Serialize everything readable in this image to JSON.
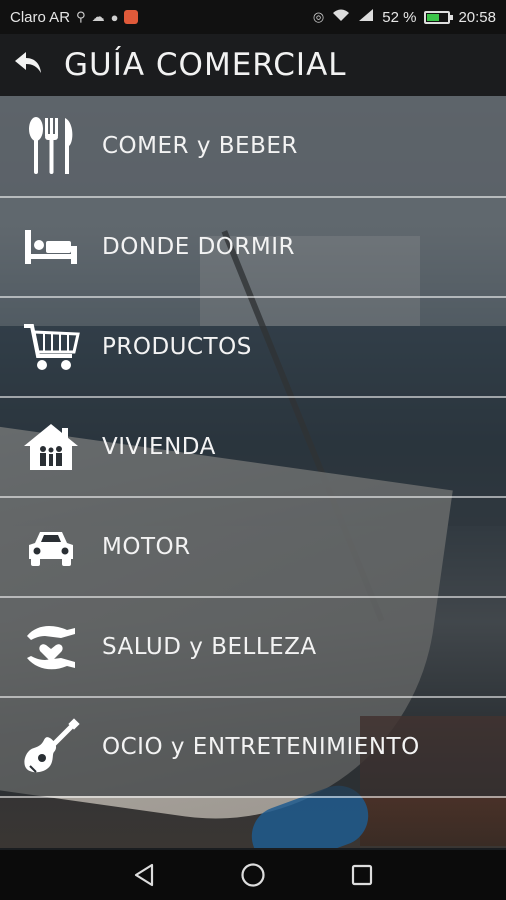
{
  "status_bar": {
    "carrier": "Claro AR",
    "battery": "52 %",
    "battery_level": 0.52,
    "time": "20:58",
    "icons": [
      "usb-icon",
      "cloud-icon",
      "chat-icon",
      "app-notification-icon",
      "nfc-icon",
      "wifi-icon",
      "signal-icon",
      "battery-icon"
    ]
  },
  "app_bar": {
    "title": "GUÍA COMERCIAL",
    "back_icon": "back-arrow-icon"
  },
  "menu": {
    "items": [
      {
        "label": "COMER y BEBER",
        "icon": "cutlery-icon"
      },
      {
        "label": "DONDE DORMIR",
        "icon": "bed-icon"
      },
      {
        "label": "PRODUCTOS",
        "icon": "shopping-cart-icon"
      },
      {
        "label": "VIVIENDA",
        "icon": "house-family-icon"
      },
      {
        "label": "MOTOR",
        "icon": "car-icon"
      },
      {
        "label": "SALUD y BELLEZA",
        "icon": "hands-heart-icon"
      },
      {
        "label": "OCIO y ENTRETENIMIENTO",
        "icon": "guitar-icon"
      }
    ]
  },
  "nav_bar": {
    "buttons": [
      "back-triangle-icon",
      "home-circle-icon",
      "recents-square-icon"
    ]
  },
  "colors": {
    "app_bar_bg": "#1b1c1e",
    "item_bg": "#282e34",
    "text": "#f3f3f3",
    "battery_fill": "#3cc44a"
  }
}
